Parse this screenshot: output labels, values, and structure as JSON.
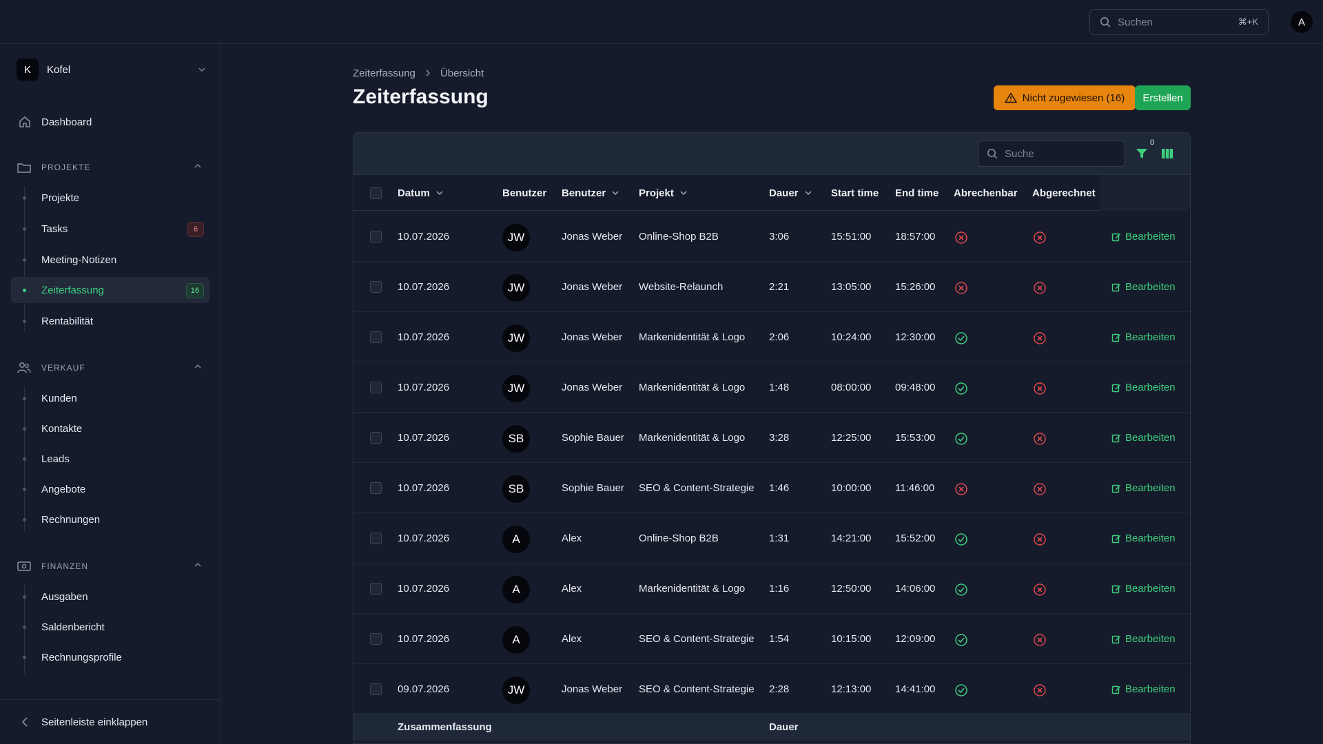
{
  "topbar": {
    "search_placeholder": "Suchen",
    "search_shortcut": "⌘+K",
    "user_initial": "A"
  },
  "sidebar": {
    "org": {
      "initial": "K",
      "name": "Kofel"
    },
    "dashboard": "Dashboard",
    "sections": [
      {
        "title": "PROJEKTE",
        "icon": "folder-icon",
        "items": [
          {
            "label": "Projekte"
          },
          {
            "label": "Tasks",
            "count": "6"
          },
          {
            "label": "Meeting-Notizen"
          },
          {
            "label": "Zeiterfassung",
            "count": "16",
            "active": true
          },
          {
            "label": "Rentabilität"
          }
        ]
      },
      {
        "title": "VERKAUF",
        "icon": "users-icon",
        "items": [
          {
            "label": "Kunden"
          },
          {
            "label": "Kontakte"
          },
          {
            "label": "Leads"
          },
          {
            "label": "Angebote"
          },
          {
            "label": "Rechnungen"
          }
        ]
      },
      {
        "title": "FINANZEN",
        "icon": "banknote-icon",
        "items": [
          {
            "label": "Ausgaben"
          },
          {
            "label": "Saldenbericht"
          },
          {
            "label": "Rechnungsprofile"
          }
        ]
      }
    ],
    "collapse_label": "Seitenleiste einklappen"
  },
  "breadcrumb": {
    "root": "Zeiterfassung",
    "current": "Übersicht"
  },
  "page": {
    "title": "Zeiterfassung",
    "unassigned_button": "Nicht zugewiesen (16)",
    "create_button": "Erstellen"
  },
  "toolbar": {
    "search_placeholder": "Suche",
    "filter_count": "0"
  },
  "colors": {
    "accent": "#3ecf7e",
    "warning": "#e8850f",
    "create": "#1fa556",
    "error": "#e5484d"
  },
  "table": {
    "headers": {
      "date": "Datum",
      "user_avatar": "Benutzer",
      "user": "Benutzer",
      "project": "Projekt",
      "duration": "Dauer",
      "start": "Start time",
      "end": "End time",
      "billable": "Abrechenbar",
      "billed": "Abgerechnet"
    },
    "edit_label": "Bearbeiten",
    "rows": [
      {
        "date": "10.07.2026",
        "initials": "JW",
        "user": "Jonas Weber",
        "project": "Online-Shop B2B",
        "duration": "3:06",
        "start": "15:51:00",
        "end": "18:57:00",
        "billable": false,
        "billed": false
      },
      {
        "date": "10.07.2026",
        "initials": "JW",
        "user": "Jonas Weber",
        "project": "Website-Relaunch",
        "duration": "2:21",
        "start": "13:05:00",
        "end": "15:26:00",
        "billable": false,
        "billed": false
      },
      {
        "date": "10.07.2026",
        "initials": "JW",
        "user": "Jonas Weber",
        "project": "Markenidentität & Logo",
        "duration": "2:06",
        "start": "10:24:00",
        "end": "12:30:00",
        "billable": true,
        "billed": false
      },
      {
        "date": "10.07.2026",
        "initials": "JW",
        "user": "Jonas Weber",
        "project": "Markenidentität & Logo",
        "duration": "1:48",
        "start": "08:00:00",
        "end": "09:48:00",
        "billable": true,
        "billed": false
      },
      {
        "date": "10.07.2026",
        "initials": "SB",
        "user": "Sophie Bauer",
        "project": "Markenidentität & Logo",
        "duration": "3:28",
        "start": "12:25:00",
        "end": "15:53:00",
        "billable": true,
        "billed": false
      },
      {
        "date": "10.07.2026",
        "initials": "SB",
        "user": "Sophie Bauer",
        "project": "SEO & Content-Strategie",
        "duration": "1:46",
        "start": "10:00:00",
        "end": "11:46:00",
        "billable": false,
        "billed": false
      },
      {
        "date": "10.07.2026",
        "initials": "A",
        "user": "Alex",
        "project": "Online-Shop B2B",
        "duration": "1:31",
        "start": "14:21:00",
        "end": "15:52:00",
        "billable": true,
        "billed": false
      },
      {
        "date": "10.07.2026",
        "initials": "A",
        "user": "Alex",
        "project": "Markenidentität & Logo",
        "duration": "1:16",
        "start": "12:50:00",
        "end": "14:06:00",
        "billable": true,
        "billed": false
      },
      {
        "date": "10.07.2026",
        "initials": "A",
        "user": "Alex",
        "project": "SEO & Content-Strategie",
        "duration": "1:54",
        "start": "10:15:00",
        "end": "12:09:00",
        "billable": true,
        "billed": false
      },
      {
        "date": "09.07.2026",
        "initials": "JW",
        "user": "Jonas Weber",
        "project": "SEO & Content-Strategie",
        "duration": "2:28",
        "start": "12:13:00",
        "end": "14:41:00",
        "billable": true,
        "billed": false
      }
    ],
    "summary": {
      "label": "Zusammenfassung",
      "duration_label": "Dauer"
    }
  }
}
